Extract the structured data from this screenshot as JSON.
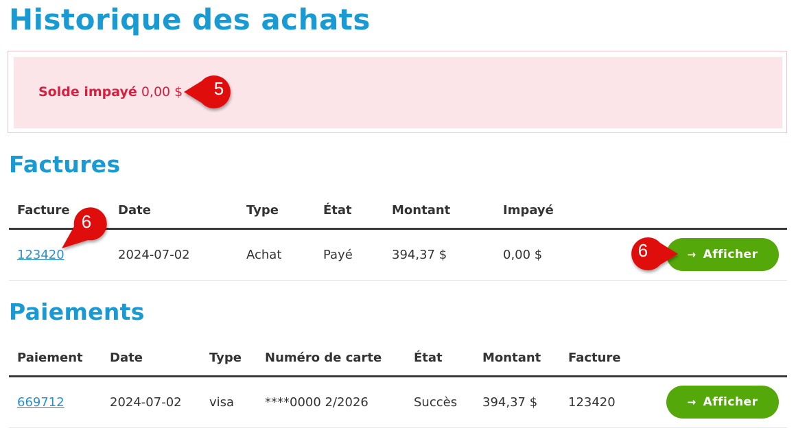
{
  "page_title": "Historique des achats",
  "alert": {
    "label": "Solde impayé",
    "value": "0,00 $"
  },
  "invoices": {
    "title": "Factures",
    "columns": [
      "Facture",
      "Date",
      "Type",
      "État",
      "Montant",
      "Impayé"
    ],
    "rows": [
      {
        "facture": "123420",
        "date": "2024-07-02",
        "type": "Achat",
        "etat": "Payé",
        "montant": "394,37 $",
        "impaye": "0,00 $",
        "button": "Afficher"
      }
    ]
  },
  "payments": {
    "title": "Paiements",
    "columns": [
      "Paiement",
      "Date",
      "Type",
      "Numéro de carte",
      "État",
      "Montant",
      "Facture"
    ],
    "rows": [
      {
        "paiement": "669712",
        "date": "2024-07-02",
        "type": "visa",
        "carte": "****0000 2/2026",
        "etat": "Succès",
        "montant": "394,37 $",
        "facture": "123420",
        "button": "Afficher"
      }
    ]
  },
  "callouts": [
    "5",
    "6",
    "6"
  ],
  "colors": {
    "heading": "#1a9ad3",
    "alert_text": "#d3213f",
    "alert_bg": "#fbe5e9",
    "button": "#55a80a",
    "callout": "#e01010",
    "link": "#2a8fd0"
  }
}
